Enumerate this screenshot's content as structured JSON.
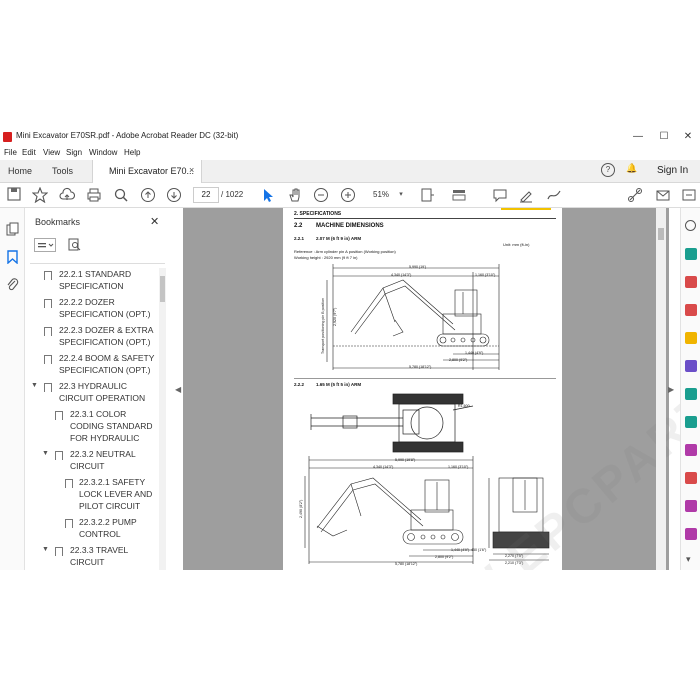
{
  "window": {
    "title": "Mini Excavator E70SR.pdf - Adobe Acrobat Reader DC (32-bit)",
    "controls": {
      "minimize": "—",
      "maximize": "☐",
      "close": "✕"
    }
  },
  "menu": [
    "File",
    "Edit",
    "View",
    "Sign",
    "Window",
    "Help"
  ],
  "tabs": {
    "home": "Home",
    "tools": "Tools",
    "document": "Mini Excavator E70...",
    "close": "×"
  },
  "tabbar_right": {
    "help": "?",
    "bell": "🔔",
    "sign_in": "Sign In"
  },
  "toolbar": {
    "page_current": "22",
    "page_total": "/ 1022",
    "zoom": "51%"
  },
  "bookmarks": {
    "header": "Bookmarks",
    "close": "✕",
    "items": [
      {
        "lines": [
          "22.2.1 STANDARD",
          "SPECIFICATION"
        ]
      },
      {
        "lines": [
          "22.2.2 DOZER",
          "SPECIFICATION (OPT.)"
        ]
      },
      {
        "lines": [
          "22.2.3 DOZER & EXTRA",
          "SPECIFICATION (OPT.)"
        ]
      },
      {
        "lines": [
          "22.2.4 BOOM & SAFETY",
          "SPECIFICATION (OPT.)"
        ]
      },
      {
        "lines": [
          "22.3 HYDRAULIC",
          "CIRCUIT OPERATION"
        ]
      },
      {
        "lines": [
          "22.3.1 COLOR",
          "CODING STANDARD",
          "FOR HYDRAULIC"
        ]
      },
      {
        "lines": [
          "22.3.2 NEUTRAL",
          "CIRCUIT"
        ]
      },
      {
        "lines": [
          "22.3.2.1 SAFETY",
          "LOCK LEVER AND",
          "PILOT CIRCUIT"
        ]
      },
      {
        "lines": [
          "22.3.2.2 PUMP",
          "CONTROL"
        ]
      },
      {
        "lines": [
          "22.3.3 TRAVEL",
          "CIRCUIT"
        ]
      }
    ]
  },
  "page": {
    "section": "2. SPECIFICATIONS",
    "h1_num": "2.2",
    "h1": "MACHINE DIMENSIONS",
    "s1_num": "2.2.1",
    "s1": "2.07 M (6 ft 9 in) ARM",
    "unit": "Unit: mm (ft-in)",
    "ref1": "Reference : Arm cylinder pin A position (Working position)",
    "ref2": "Working height : 2920 mm (9 ft 7 in)",
    "d_5990": "5,990 (19')",
    "d_4340": "4,340 (14'3\")",
    "d_1160": "1,160 (3'10\")",
    "d_2920v": "2,920 (9'7\")",
    "transport_label": "Transport positioning pin B position",
    "d_1440": "1,440 (4'9\")",
    "d_2800": "2,800 (9'2\")",
    "d_5780": "5,780 (18'12\")",
    "s2_num": "2.2.2",
    "s2": "1.65 M (5 ft 5 in) ARM",
    "r_1600": "R1,600",
    "d2_5990": "5,990 (19'8\")",
    "d2_4340": "4,340 (14'3\")",
    "d2_1160": "1,160 (3'10\")",
    "d2_2490": "2,490 (8'2\")",
    "d2_1440": "1,440 (4'9\")",
    "d2_2800": "2,800 (9'2\")",
    "d2_5780": "5,780 (18'12\")",
    "f_450": "450 (1'6\")",
    "f_2270": "2,270 (7'5\")",
    "f_2210": "2,210 (7'3\")",
    "watermark": "WWW.EPCPARTS.COM"
  }
}
